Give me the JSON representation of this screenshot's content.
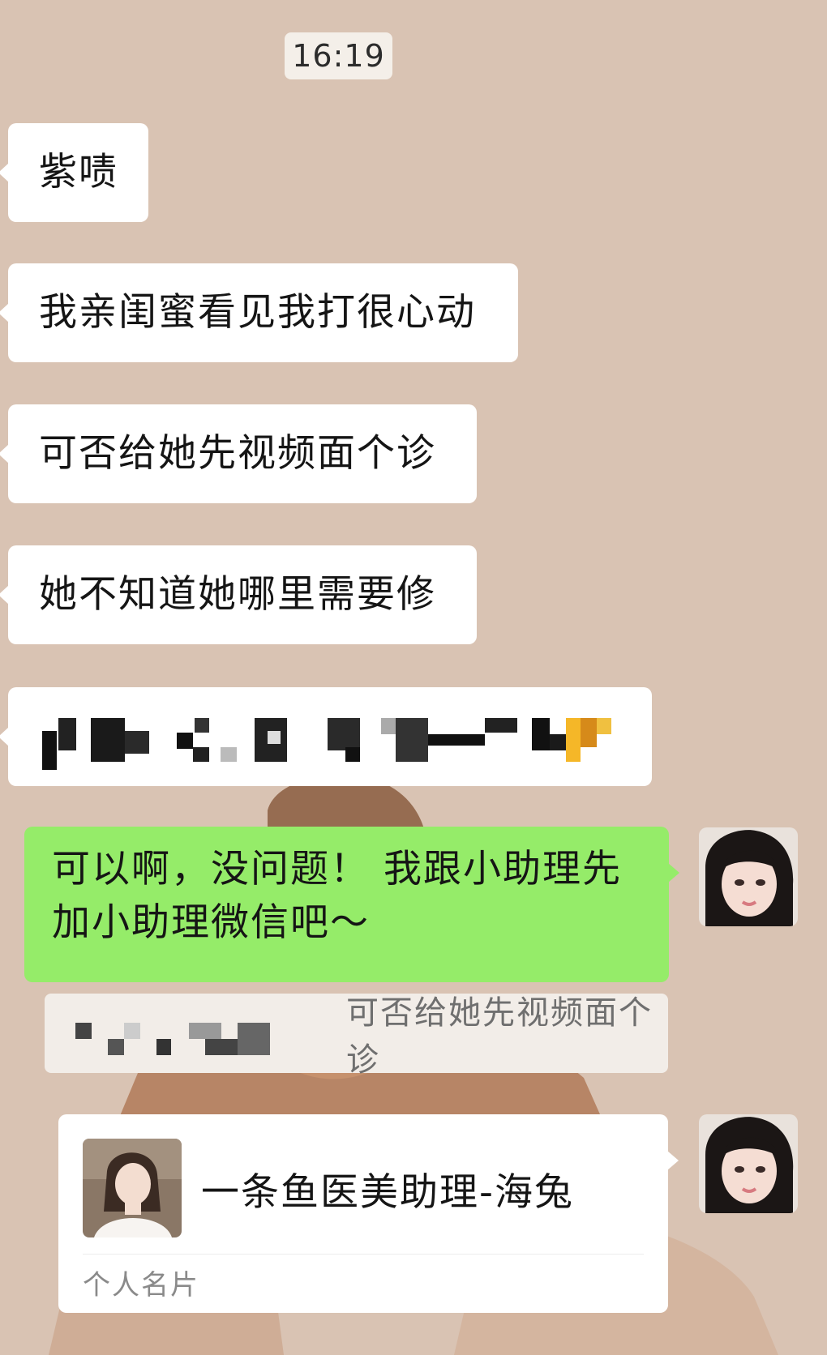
{
  "chat": {
    "timestamp": "16:19",
    "incoming": [
      "紫啧",
      "我亲闺蜜看见我打很心动",
      "可否给她先视频面个诊",
      "她不知道她哪里需要修"
    ],
    "outgoing_reply": {
      "line1": "可以啊，没问题！ 我跟小助理先",
      "line2": "加小助理微信吧～"
    },
    "quoted_message": "可否给她先视频面个诊",
    "contact_card": {
      "name": "一条鱼医美助理-海兔",
      "label": "个人名片"
    }
  },
  "colors": {
    "background": "#d9c3b3",
    "incoming_bubble": "#ffffff",
    "outgoing_bubble": "#95ec69",
    "quote_bg": "#f2ede8"
  },
  "icons": {
    "self_avatar": "user-avatar-icon",
    "contact_avatar": "contact-avatar-icon"
  }
}
